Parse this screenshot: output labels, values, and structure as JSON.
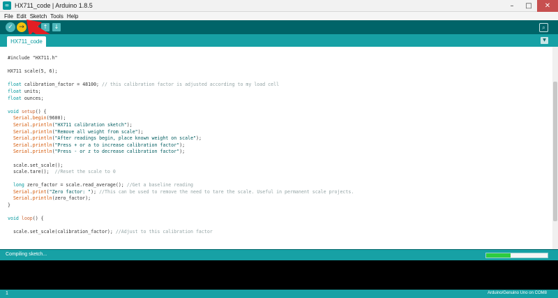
{
  "window": {
    "title": "HX711_code | Arduino 1.8.5",
    "minimize": "–",
    "maximize": "□",
    "close": "✕"
  },
  "menu": [
    "File",
    "Edit",
    "Sketch",
    "Tools",
    "Help"
  ],
  "toolbar": {
    "verify_icon": "✓",
    "upload_icon": "→",
    "new_icon": "▫",
    "open_icon": "↑",
    "save_icon": "↓",
    "serial_icon": "⌕",
    "annotation_color": "#e31e24"
  },
  "tabs": {
    "active": "HX711_code",
    "menu_icon": "▼"
  },
  "editor": {
    "lines": [
      [
        {
          "t": "#include \"HX711.h\"",
          "c": "plain"
        }
      ],
      [],
      [
        {
          "t": "HX711 scale(5, 6);",
          "c": "plain"
        }
      ],
      [],
      [
        {
          "t": "float",
          "c": "type"
        },
        {
          "t": " calibration_factor = 48100; ",
          "c": "plain"
        },
        {
          "t": "// this calibration factor is adjusted according to my load cell",
          "c": "com"
        }
      ],
      [
        {
          "t": "float",
          "c": "type"
        },
        {
          "t": " units;",
          "c": "plain"
        }
      ],
      [
        {
          "t": "float",
          "c": "type"
        },
        {
          "t": " ounces;",
          "c": "plain"
        }
      ],
      [],
      [
        {
          "t": "void",
          "c": "type"
        },
        {
          "t": " ",
          "c": "plain"
        },
        {
          "t": "setup",
          "c": "kw"
        },
        {
          "t": "() {",
          "c": "plain"
        }
      ],
      [
        {
          "t": "  ",
          "c": "plain"
        },
        {
          "t": "Serial",
          "c": "fn"
        },
        {
          "t": ".",
          "c": "plain"
        },
        {
          "t": "begin",
          "c": "fn"
        },
        {
          "t": "(9600);",
          "c": "plain"
        }
      ],
      [
        {
          "t": "  ",
          "c": "plain"
        },
        {
          "t": "Serial",
          "c": "fn"
        },
        {
          "t": ".",
          "c": "plain"
        },
        {
          "t": "println",
          "c": "fn"
        },
        {
          "t": "(",
          "c": "plain"
        },
        {
          "t": "\"HX711 calibration sketch\"",
          "c": "str"
        },
        {
          "t": ");",
          "c": "plain"
        }
      ],
      [
        {
          "t": "  ",
          "c": "plain"
        },
        {
          "t": "Serial",
          "c": "fn"
        },
        {
          "t": ".",
          "c": "plain"
        },
        {
          "t": "println",
          "c": "fn"
        },
        {
          "t": "(",
          "c": "plain"
        },
        {
          "t": "\"Remove all weight from scale\"",
          "c": "str"
        },
        {
          "t": ");",
          "c": "plain"
        }
      ],
      [
        {
          "t": "  ",
          "c": "plain"
        },
        {
          "t": "Serial",
          "c": "fn"
        },
        {
          "t": ".",
          "c": "plain"
        },
        {
          "t": "println",
          "c": "fn"
        },
        {
          "t": "(",
          "c": "plain"
        },
        {
          "t": "\"After readings begin, place known weight on scale\"",
          "c": "str"
        },
        {
          "t": ");",
          "c": "plain"
        }
      ],
      [
        {
          "t": "  ",
          "c": "plain"
        },
        {
          "t": "Serial",
          "c": "fn"
        },
        {
          "t": ".",
          "c": "plain"
        },
        {
          "t": "println",
          "c": "fn"
        },
        {
          "t": "(",
          "c": "plain"
        },
        {
          "t": "\"Press + or a to increase calibration factor\"",
          "c": "str"
        },
        {
          "t": ");",
          "c": "plain"
        }
      ],
      [
        {
          "t": "  ",
          "c": "plain"
        },
        {
          "t": "Serial",
          "c": "fn"
        },
        {
          "t": ".",
          "c": "plain"
        },
        {
          "t": "println",
          "c": "fn"
        },
        {
          "t": "(",
          "c": "plain"
        },
        {
          "t": "\"Press - or z to decrease calibration factor\"",
          "c": "str"
        },
        {
          "t": ");",
          "c": "plain"
        }
      ],
      [],
      [
        {
          "t": "  scale.set_scale();",
          "c": "plain"
        }
      ],
      [
        {
          "t": "  scale.tare();  ",
          "c": "plain"
        },
        {
          "t": "//Reset the scale to 0",
          "c": "com"
        }
      ],
      [],
      [
        {
          "t": "  ",
          "c": "plain"
        },
        {
          "t": "long",
          "c": "type"
        },
        {
          "t": " zero_factor = scale.read_average(); ",
          "c": "plain"
        },
        {
          "t": "//Get a baseline reading",
          "c": "com"
        }
      ],
      [
        {
          "t": "  ",
          "c": "plain"
        },
        {
          "t": "Serial",
          "c": "fn"
        },
        {
          "t": ".",
          "c": "plain"
        },
        {
          "t": "print",
          "c": "fn"
        },
        {
          "t": "(",
          "c": "plain"
        },
        {
          "t": "\"Zero factor: \"",
          "c": "str"
        },
        {
          "t": "); ",
          "c": "plain"
        },
        {
          "t": "//This can be used to remove the need to tare the scale. Useful in permanent scale projects.",
          "c": "com"
        }
      ],
      [
        {
          "t": "  ",
          "c": "plain"
        },
        {
          "t": "Serial",
          "c": "fn"
        },
        {
          "t": ".",
          "c": "plain"
        },
        {
          "t": "println",
          "c": "fn"
        },
        {
          "t": "(zero_factor);",
          "c": "plain"
        }
      ],
      [
        {
          "t": "}",
          "c": "plain"
        }
      ],
      [],
      [
        {
          "t": "void",
          "c": "type"
        },
        {
          "t": " ",
          "c": "plain"
        },
        {
          "t": "loop",
          "c": "kw"
        },
        {
          "t": "() {",
          "c": "plain"
        }
      ],
      [],
      [
        {
          "t": "  scale.set_scale(calibration_factor); ",
          "c": "plain"
        },
        {
          "t": "//Adjust to this calibration factor",
          "c": "com"
        }
      ]
    ]
  },
  "status": {
    "message": "Compiling sketch...",
    "progress_fraction": 0.4
  },
  "footer": {
    "line_number": "1",
    "board": "Arduino/Genuino Uno on COM8"
  }
}
